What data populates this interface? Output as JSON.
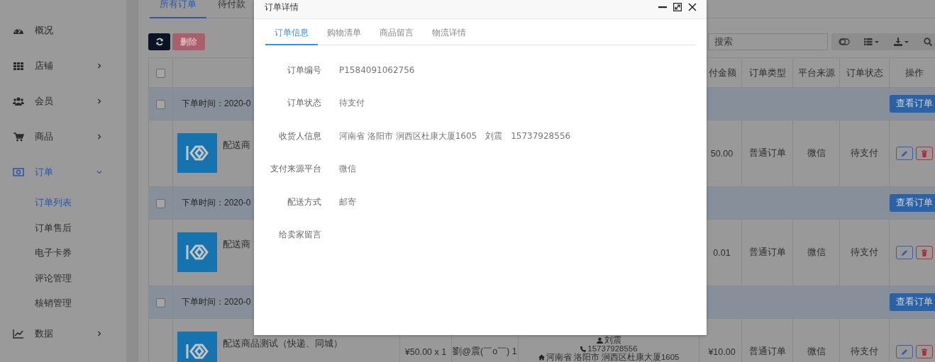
{
  "sidebar": {
    "items": [
      {
        "label": "概况",
        "kind": "link",
        "selected": false
      },
      {
        "label": "店铺",
        "kind": "menu",
        "selected": false,
        "expanded": false
      },
      {
        "label": "会员",
        "kind": "menu",
        "selected": false,
        "expanded": false
      },
      {
        "label": "商品",
        "kind": "menu",
        "selected": false,
        "expanded": false
      },
      {
        "label": "订单",
        "kind": "menu",
        "selected": true,
        "expanded": true,
        "children": [
          {
            "label": "订单列表",
            "selected": true
          },
          {
            "label": "订单售后",
            "selected": false
          },
          {
            "label": "电子卡券",
            "selected": false
          },
          {
            "label": "评论管理",
            "selected": false
          },
          {
            "label": "核销管理",
            "selected": false
          }
        ]
      },
      {
        "label": "数据",
        "kind": "menu",
        "selected": false,
        "expanded": false
      }
    ]
  },
  "page_tabs": [
    {
      "label": "所有订单",
      "selected": true
    },
    {
      "label": "待付款",
      "selected": false
    }
  ],
  "toolbar": {
    "delete_label": "删除",
    "delete_disabled": true,
    "search_placeholder": "搜索"
  },
  "table": {
    "header_checked": false,
    "columns": [
      "付金额",
      "订单类型",
      "平台来源",
      "订单状态",
      "操作"
    ],
    "orders": [
      {
        "checked": false,
        "time": "下单时间：2020-0",
        "view_label": "查看订单",
        "product": "配送商",
        "amount": "50.00",
        "type": "普通订单",
        "platform": "微信",
        "status": "待支付"
      },
      {
        "checked": false,
        "time": "下单时间：2020-0",
        "view_label": "查看订单",
        "product": "配送商",
        "amount": "0.01",
        "type": "普通订单",
        "platform": "微信",
        "status": "待支付"
      },
      {
        "checked": false,
        "time": "下单时间：2020-0",
        "view_label": "查看订单",
        "product": "配送商品测试（快递、同城）",
        "price": "¥50.00 x 1",
        "buyer": "劉@震(￣o￣) 1",
        "receiver": {
          "name": "刘震",
          "phone": "15737928556",
          "address": "河南省 洛阳市 涧西区杜康大厦1605"
        },
        "amount": "¥10.00",
        "type": "普通订单",
        "platform": "微信",
        "status": "待支付"
      }
    ]
  },
  "modal": {
    "title": "订单详情",
    "tabs": [
      {
        "label": "订单信息",
        "selected": true
      },
      {
        "label": "购物清单",
        "selected": false
      },
      {
        "label": "商品留言",
        "selected": false
      },
      {
        "label": "物流详情",
        "selected": false
      }
    ],
    "fields": [
      {
        "label": "订单编号",
        "value": "P1584091062756"
      },
      {
        "label": "订单状态",
        "value": "待支付"
      },
      {
        "label": "收货人信息",
        "value": "河南省 洛阳市 涧西区杜康大厦1605　刘震　15737928556"
      },
      {
        "label": "支付来源平台",
        "value": "微信"
      },
      {
        "label": "配送方式",
        "value": "邮寄"
      },
      {
        "label": "给卖家留言"
      }
    ]
  }
}
